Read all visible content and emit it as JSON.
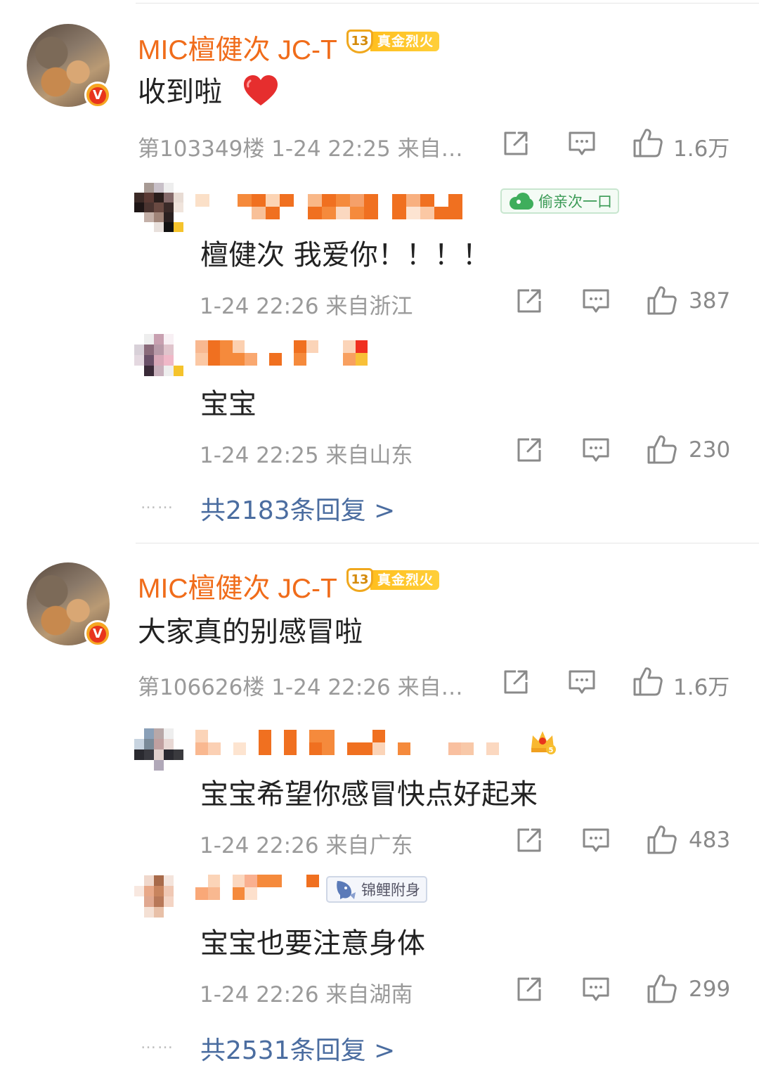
{
  "comments": [
    {
      "username": "MIC檀健次 JC-T",
      "badge_level": "13",
      "badge_text": "真金烈火",
      "verified": "V",
      "text": "收到啦",
      "emoji": "heart",
      "floor_meta": "第103349楼 1-24 22:25 来自…",
      "likes": "1.6万",
      "replies": [
        {
          "badge_text": "偷亲次一口",
          "text": "檀健次 我爱你！！！！",
          "meta": "1-24 22:26 来自浙江",
          "likes": "387"
        },
        {
          "text": "宝宝",
          "meta": "1-24 22:25 来自山东",
          "likes": "230"
        }
      ],
      "more_replies": "共2183条回复 >"
    },
    {
      "username": "MIC檀健次 JC-T",
      "badge_level": "13",
      "badge_text": "真金烈火",
      "verified": "V",
      "text": "大家真的别感冒啦",
      "floor_meta": "第106626楼 1-24 22:26 来自…",
      "likes": "1.6万",
      "replies": [
        {
          "badge_level": "5",
          "text": "宝宝希望你感冒快点好起来",
          "meta": "1-24 22:26 来自广东",
          "likes": "483"
        },
        {
          "badge_text": "锦鲤附身",
          "text": "宝宝也要注意身体",
          "meta": "1-24 22:26 来自湖南",
          "likes": "299"
        }
      ],
      "more_replies": "共2531条回复 >"
    }
  ],
  "more_dots": "……",
  "icons": {
    "share": "share-icon",
    "comment": "comment-icon",
    "like": "thumbs-up-icon",
    "heart": "heart-icon",
    "cloud": "cloud-icon",
    "koi": "koi-fish-icon",
    "crown": "crown-icon"
  },
  "colors": {
    "username": "#f06c1a",
    "link": "#4b6da0",
    "meta": "#9a9a9a",
    "badge_gold": "#ffbf1f"
  }
}
